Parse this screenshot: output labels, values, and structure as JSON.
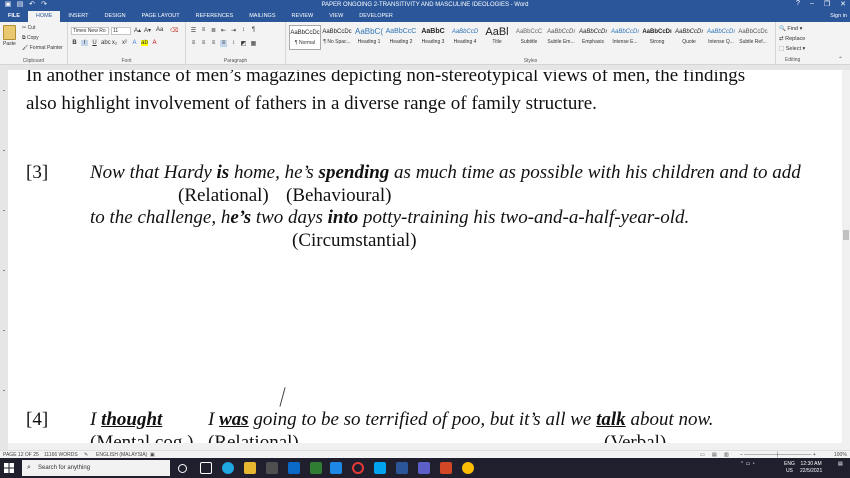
{
  "titlebar": {
    "title": "PAPER ONGOING 2-TRANSITIVITY AND MASCULINE IDEOLOGIES - Word",
    "minimize": "–",
    "restore": "❐",
    "close": "✕"
  },
  "tabs": [
    "FILE",
    "HOME",
    "INSERT",
    "DESIGN",
    "PAGE LAYOUT",
    "REFERENCES",
    "MAILINGS",
    "REVIEW",
    "VIEW",
    "DEVELOPER"
  ],
  "signin": "Sign in",
  "ribbon": {
    "clipboard": {
      "paste": "Paste",
      "cut": "Cut",
      "copy": "Copy",
      "painter": "Format Painter",
      "label": "Clipboard"
    },
    "font": {
      "name": "Times New Ro",
      "size": "11",
      "label": "Font",
      "bold": "B",
      "italic": "I",
      "underline": "U",
      "grow": "A",
      "shrink": "A",
      "clear": "Aa"
    },
    "paragraph": {
      "label": "Paragraph"
    },
    "styles": {
      "label": "Styles",
      "items": [
        {
          "preview": "AaBbCcDc",
          "name": "¶ Normal"
        },
        {
          "preview": "AaBbCcDc",
          "name": "¶ No Spac..."
        },
        {
          "preview": "AaBbC(",
          "name": "Heading 1"
        },
        {
          "preview": "AaBbCcC",
          "name": "Heading 2"
        },
        {
          "preview": "AaBbC",
          "name": "Heading 3"
        },
        {
          "preview": "AaBbCcD",
          "name": "Heading 4"
        },
        {
          "preview": "AaBl",
          "name": "Title"
        },
        {
          "preview": "AaBbCcC",
          "name": "Subtitle"
        },
        {
          "preview": "AaBbCcDı",
          "name": "Subtle Em..."
        },
        {
          "preview": "AaBbCcDı",
          "name": "Emphasis"
        },
        {
          "preview": "AaBbCcDı",
          "name": "Intense E..."
        },
        {
          "preview": "AaBbCcDı",
          "name": "Strong"
        },
        {
          "preview": "AaBbCcDı",
          "name": "Quote"
        },
        {
          "preview": "AaBbCcDı",
          "name": "Intense Q..."
        },
        {
          "preview": "AaBbCcDc",
          "name": "Subtle Ref..."
        }
      ]
    },
    "editing": {
      "find": "Find",
      "replace": "Replace",
      "select": "Select",
      "label": "Editing"
    }
  },
  "document": {
    "p1_line1": "In another instance of men’s magazines depicting non-stereotypical views of men, the findings",
    "p1_line2": "also highlight involvement of fathers in a diverse range of family structure.",
    "ex3": {
      "num": "[3]",
      "s1": "Now that Hardy ",
      "s2": "is",
      "s3": " home, he’s ",
      "s4": "spending",
      "s5": " as much time as possible with his children and to add",
      "tag1": "(Relational)",
      "tag2": "(Behavioural)",
      "l2a": "to the challenge, h",
      "l2b": "e’s",
      "l2c": " two days ",
      "l2d": "into",
      "l2e": " potty-training his two-and-a-half-year-old.",
      "tag3": "(Circumstantial)"
    },
    "ex4": {
      "num": "[4]",
      "w1": "I ",
      "w2": "thought",
      "w3": "I ",
      "w4": "was",
      "w5": " going to be so terrified of poo, but it’s all we ",
      "w6": "talk",
      "w7": " about now.",
      "tag1": "(Mental cog.)",
      "tag2": "(Relational)",
      "tag3": "(Verbal)"
    }
  },
  "status": {
    "page": "PAGE 12 OF 25",
    "words": "11166 WORDS",
    "lang": "ENGLISH (MALAYSIA)",
    "zoom": "100%"
  },
  "taskbar": {
    "search": "Search for anything",
    "lang1": "ENG",
    "lang2": "US",
    "time": "12:30 AM",
    "date": "22/5/2021"
  }
}
